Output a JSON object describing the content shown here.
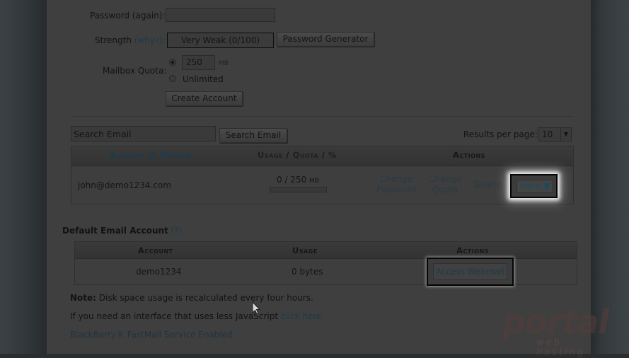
{
  "form": {
    "password_again_label": "Password (again):",
    "strength_label": "Strength",
    "strength_why": "(why?):",
    "strength_value": "Very Weak (0/100)",
    "password_generator_label": "Password Generator",
    "mailbox_quota_label": "Mailbox Quota:",
    "quota_value": "250",
    "quota_unit": "MB",
    "unlimited_label": "Unlimited",
    "create_account_label": "Create Account"
  },
  "search": {
    "placeholder": "Search Email",
    "button_label": "Search Email",
    "results_per_page_label": "Results per page:",
    "results_per_page_value": "10"
  },
  "accounts_table": {
    "headers": {
      "account": "Account @ Domain",
      "usage": "Usage",
      "sep1": "/",
      "quota": "Quota",
      "sep2": "/",
      "pct": "%",
      "actions": "Actions"
    },
    "rows": [
      {
        "email": "john@demo1234.com",
        "usage": "0 / 250",
        "usage_unit": "MB",
        "usage_fraction": 0.0,
        "change_password": "Change Password",
        "change_quota": "Change Quota",
        "delete": "Delete",
        "more": "More ▼"
      }
    ]
  },
  "default_account": {
    "heading": "Default Email Account",
    "help": "(?)",
    "headers": {
      "account": "Account",
      "usage": "Usage",
      "actions": "Actions"
    },
    "row": {
      "account": "demo1234",
      "usage": "0 bytes",
      "access_webmail": "Access Webmail"
    }
  },
  "notes": {
    "note_label": "Note:",
    "note_text": "Disk space usage is recalculated every four hours.",
    "less_js_text": "If you need an interface that uses less JavaScript",
    "click_here": "click here.",
    "blackberry": "BlackBerry® FastMail Service Enabled"
  },
  "watermark": {
    "main": "portal",
    "sub": "web hosting"
  },
  "colors": {
    "highlight_glow": "#ffffff",
    "dim_overlay": "#000000",
    "link": "#1d3a48"
  }
}
